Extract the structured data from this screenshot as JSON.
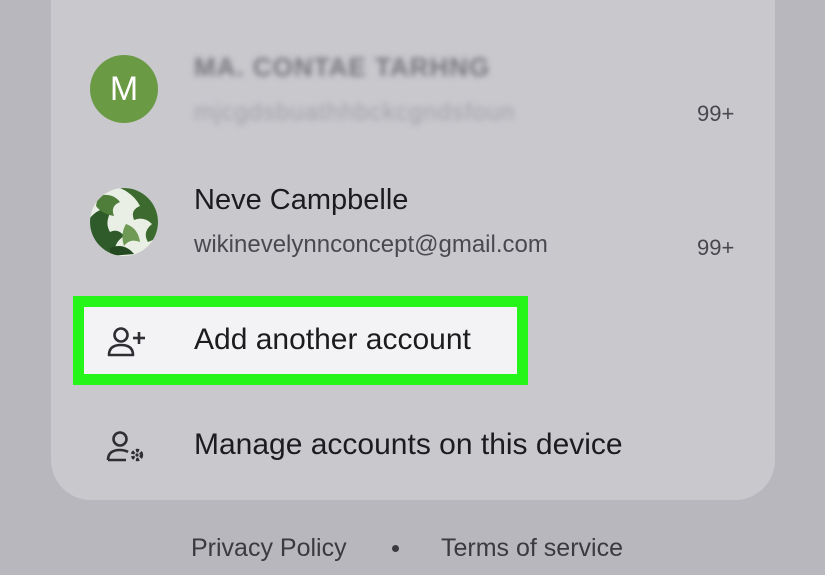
{
  "accounts": [
    {
      "avatar_letter": "M",
      "avatar_color": "#6b9a45",
      "name": "MA. CONTAE TARHNG",
      "email": "mjcgdsbuathhbckcgndsfoun",
      "count": "99+",
      "obscured": true
    },
    {
      "avatar_icon": "monstera-leaf-photo",
      "name": "Neve Campbelle",
      "email": "wikinevelynnconcept@gmail.com",
      "count": "99+",
      "obscured": false
    }
  ],
  "actions": {
    "add_account": {
      "label": "Add another account",
      "icon": "add-person-icon",
      "highlighted": true,
      "highlight_color": "#25f518"
    },
    "manage_accounts": {
      "label": "Manage accounts on this device",
      "icon": "manage-accounts-icon"
    }
  },
  "footer": {
    "privacy": "Privacy Policy",
    "terms": "Terms of service"
  }
}
